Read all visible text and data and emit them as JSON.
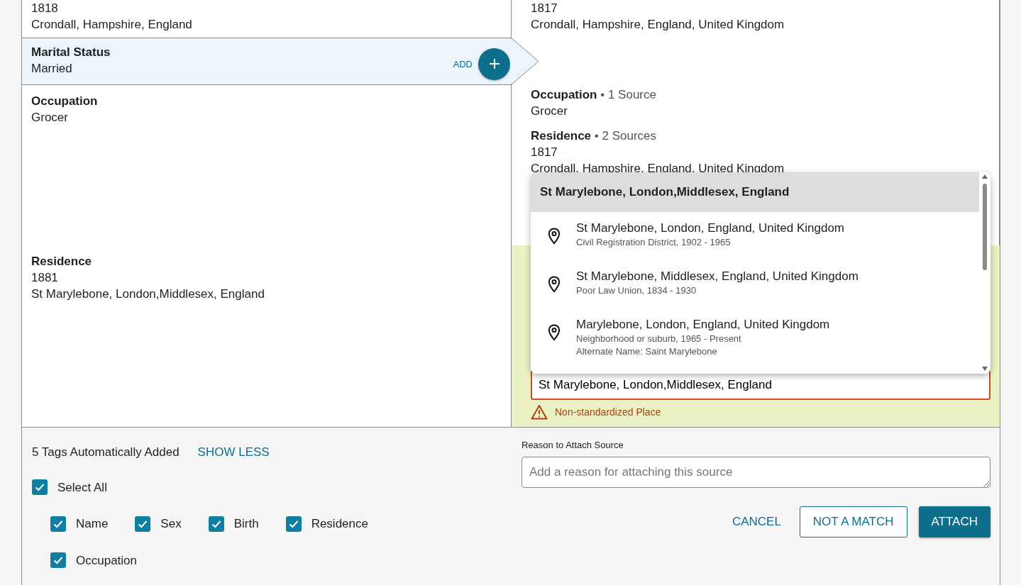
{
  "left_facts": [
    {
      "highlighted": false,
      "lines": [
        "1818",
        "Crondall, Hampshire, England"
      ]
    },
    {
      "highlighted": true,
      "label": "Marital Status",
      "lines": [
        "Married"
      ],
      "action": "ADD"
    },
    {
      "highlighted": false,
      "label": "Occupation",
      "lines": [
        "Grocer"
      ]
    },
    {
      "highlighted": false,
      "label": "Residence",
      "lines": [
        "1881",
        "St Marylebone, London,Middlesex, England"
      ]
    }
  ],
  "right_facts": [
    {
      "lines": [
        "1817",
        "Crondall, Hampshire, England, United Kingdom"
      ]
    },
    {
      "label": "Occupation",
      "sources": "• 1 Source",
      "lines": [
        "Grocer"
      ]
    },
    {
      "label": "Residence",
      "sources": "• 2 Sources",
      "lines": [
        "1817",
        "Crondall, Hampshire, England, United Kingdom"
      ]
    }
  ],
  "place_editor": {
    "value": "St Marylebone, London,Middlesex, England",
    "warning": "Non-standardized Place",
    "suggestions": {
      "header": {
        "label": "St Marylebone, London,Middlesex, England",
        "selected": true
      },
      "items": [
        {
          "selected": false,
          "title": "St Marylebone, London, England, United Kingdom",
          "details": [
            "Civil Registration District, 1902 - 1965"
          ]
        },
        {
          "selected": false,
          "title": "St Marylebone, Middlesex, England, United Kingdom",
          "details": [
            "Poor Law Union, 1834 - 1930"
          ]
        },
        {
          "selected": false,
          "title": "Marylebone, London, England, United Kingdom",
          "details": [
            "Neighborhood or suburb, 1965 - Present",
            "Alternate Name: Saint Marylebone"
          ]
        }
      ]
    }
  },
  "tags": {
    "summary": "5 Tags Automatically Added",
    "toggle": "SHOW LESS",
    "select_all": {
      "label": "Select All",
      "checked": true
    },
    "items": [
      {
        "label": "Name",
        "checked": true
      },
      {
        "label": "Sex",
        "checked": true
      },
      {
        "label": "Birth",
        "checked": true
      },
      {
        "label": "Residence",
        "checked": true
      },
      {
        "label": "Occupation",
        "checked": true
      }
    ]
  },
  "reason": {
    "label": "Reason to Attach Source",
    "placeholder": "Add a reason for attaching this source"
  },
  "buttons": [
    {
      "label": "CANCEL",
      "kind": "link"
    },
    {
      "label": "NOT A MATCH",
      "kind": "outline"
    },
    {
      "label": "ATTACH",
      "kind": "primary"
    }
  ]
}
